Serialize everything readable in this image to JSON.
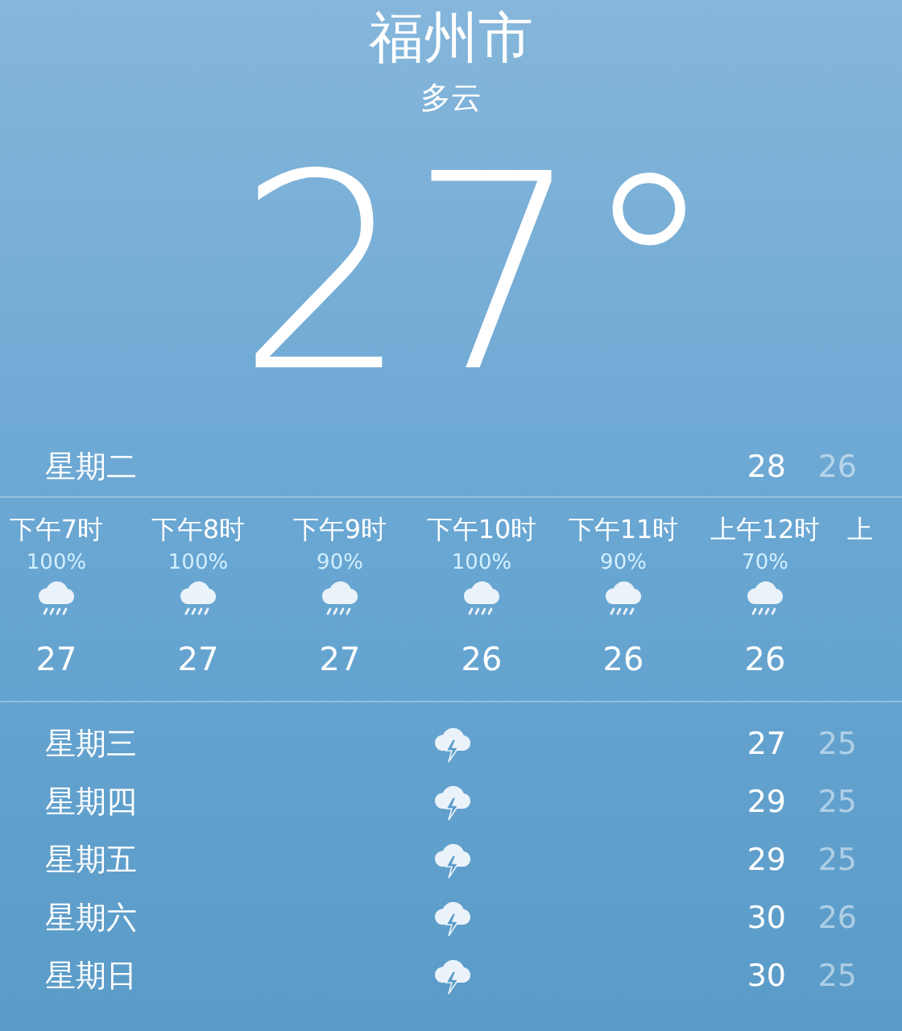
{
  "location": {
    "city": "福州市",
    "condition": "多云",
    "temperature": "27°"
  },
  "today": {
    "day": "星期二",
    "high": "28",
    "low": "26"
  },
  "hourly": [
    {
      "time": "下午7时",
      "precip": "100%",
      "temp": "27"
    },
    {
      "time": "下午8时",
      "precip": "100%",
      "temp": "27"
    },
    {
      "time": "下午9时",
      "precip": "90%",
      "temp": "27"
    },
    {
      "time": "下午10时",
      "precip": "100%",
      "temp": "26"
    },
    {
      "time": "下午11时",
      "precip": "90%",
      "temp": "26"
    },
    {
      "time": "上午12时",
      "precip": "70%",
      "temp": "26"
    },
    {
      "time": "上"
    }
  ],
  "daily": [
    {
      "day": "星期三",
      "high": "27",
      "low": "25"
    },
    {
      "day": "星期四",
      "high": "29",
      "low": "25"
    },
    {
      "day": "星期五",
      "high": "29",
      "low": "25"
    },
    {
      "day": "星期六",
      "high": "30",
      "low": "26"
    },
    {
      "day": "星期日",
      "high": "30",
      "low": "25"
    }
  ]
}
